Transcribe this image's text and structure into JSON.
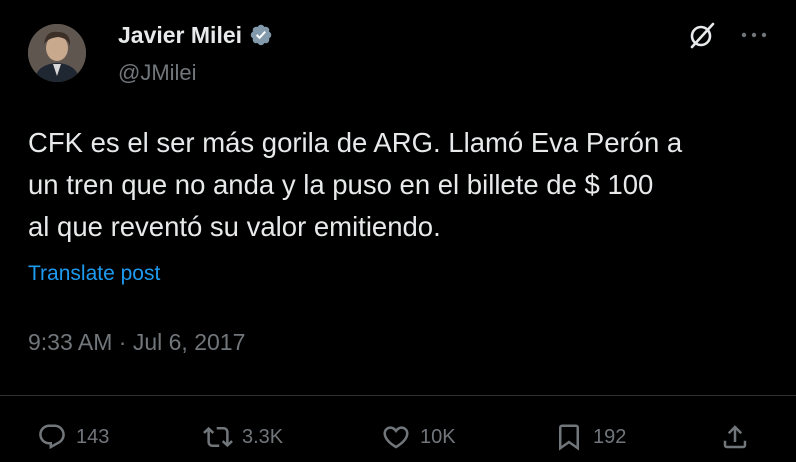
{
  "author": {
    "name": "Javier Milei",
    "handle": "@JMilei",
    "verified": true
  },
  "post": {
    "text": "CFK es el ser más gorila de ARG. Llamó Eva Perón a\nun tren que no anda y la puso en el billete de $ 100\nal que reventó su valor emitiendo.",
    "translate_label": "Translate post",
    "timestamp": "9:33 AM · Jul 6, 2017"
  },
  "actions": {
    "replies": "143",
    "reposts": "3.3K",
    "likes": "10K",
    "bookmarks": "192"
  },
  "colors": {
    "background": "#000000",
    "text": "#e7e9ea",
    "muted": "#71767b",
    "link": "#1d9bf0",
    "verified_badge": "#829aab"
  },
  "icons": [
    "verified-icon",
    "grok-icon",
    "more-icon",
    "reply-icon",
    "repost-icon",
    "like-icon",
    "bookmark-icon",
    "share-icon"
  ]
}
